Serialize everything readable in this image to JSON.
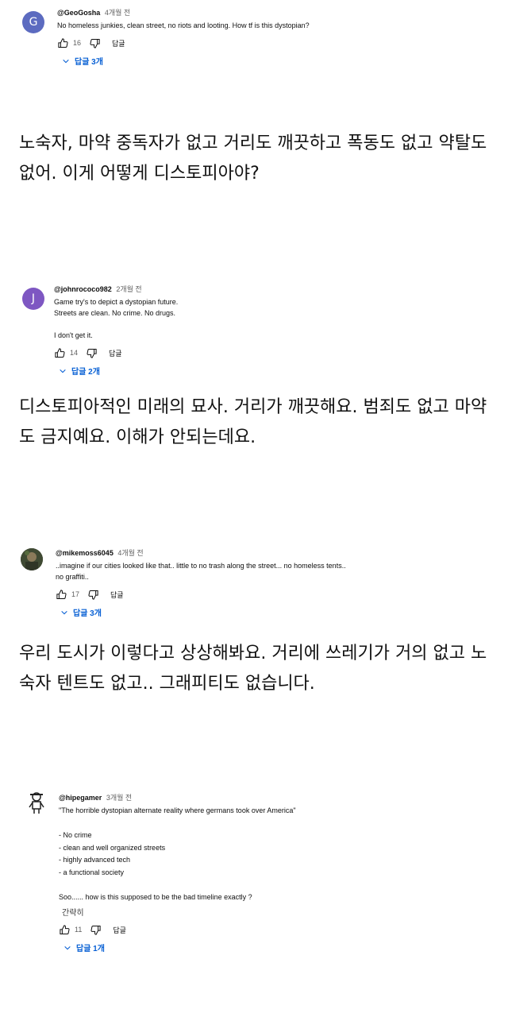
{
  "comments": [
    {
      "handle": "@GeoGosha",
      "time": "4개월 전",
      "avatar_letter": "G",
      "avatar_color": "#5c6bc0",
      "text": "No homeless junkies, clean street, no riots and looting. How tf is this dystopian?",
      "likes": "16",
      "reply_label": "답글",
      "replies": "답글 3개",
      "translation": "노숙자, 마약 중독자가 없고 거리도 깨끗하고 폭동도 없고 약탈도 없어. 이게 어떻게 디스토피아야?"
    },
    {
      "handle": "@johnrococo982",
      "time": "2개월 전",
      "avatar_letter": "J",
      "avatar_color": "#7e57c2",
      "text": "Game try's to depict a dystopian future.\nStreets are clean. No crime. No drugs.\n\nI don't get it.",
      "likes": "14",
      "reply_label": "답글",
      "replies": "답글 2개",
      "translation": "디스토피아적인 미래의 묘사. 거리가 깨끗해요. 범죄도 없고 마약도 금지예요. 이해가 안되는데요."
    },
    {
      "handle": "@mikemoss6045",
      "time": "4개월 전",
      "avatar_letter": "",
      "avatar_color": "#4a4a3a",
      "text": "..imagine if our cities looked like that.. little to no trash along the street... no homeless tents..\nno graffiti..",
      "likes": "17",
      "reply_label": "답글",
      "replies": "답글 3개",
      "translation": "우리 도시가 이렇다고 상상해봐요. 거리에 쓰레기가 거의 없고 노숙자 텐트도 없고.. 그래피티도 없습니다."
    },
    {
      "handle": "@hipegamer",
      "time": "3개월 전",
      "avatar_letter": "",
      "avatar_color": "#ffffff",
      "text": "\"The horrible dystopian alternate reality where germans took over America\"\n\n- No crime\n- clean and well organized streets\n- highly advanced tech\n- a functional society\n\nSoo...... how is this supposed to be the bad timeline exactly ?",
      "extra": "간략히",
      "likes": "11",
      "reply_label": "답글",
      "replies": "답글 1개"
    }
  ]
}
